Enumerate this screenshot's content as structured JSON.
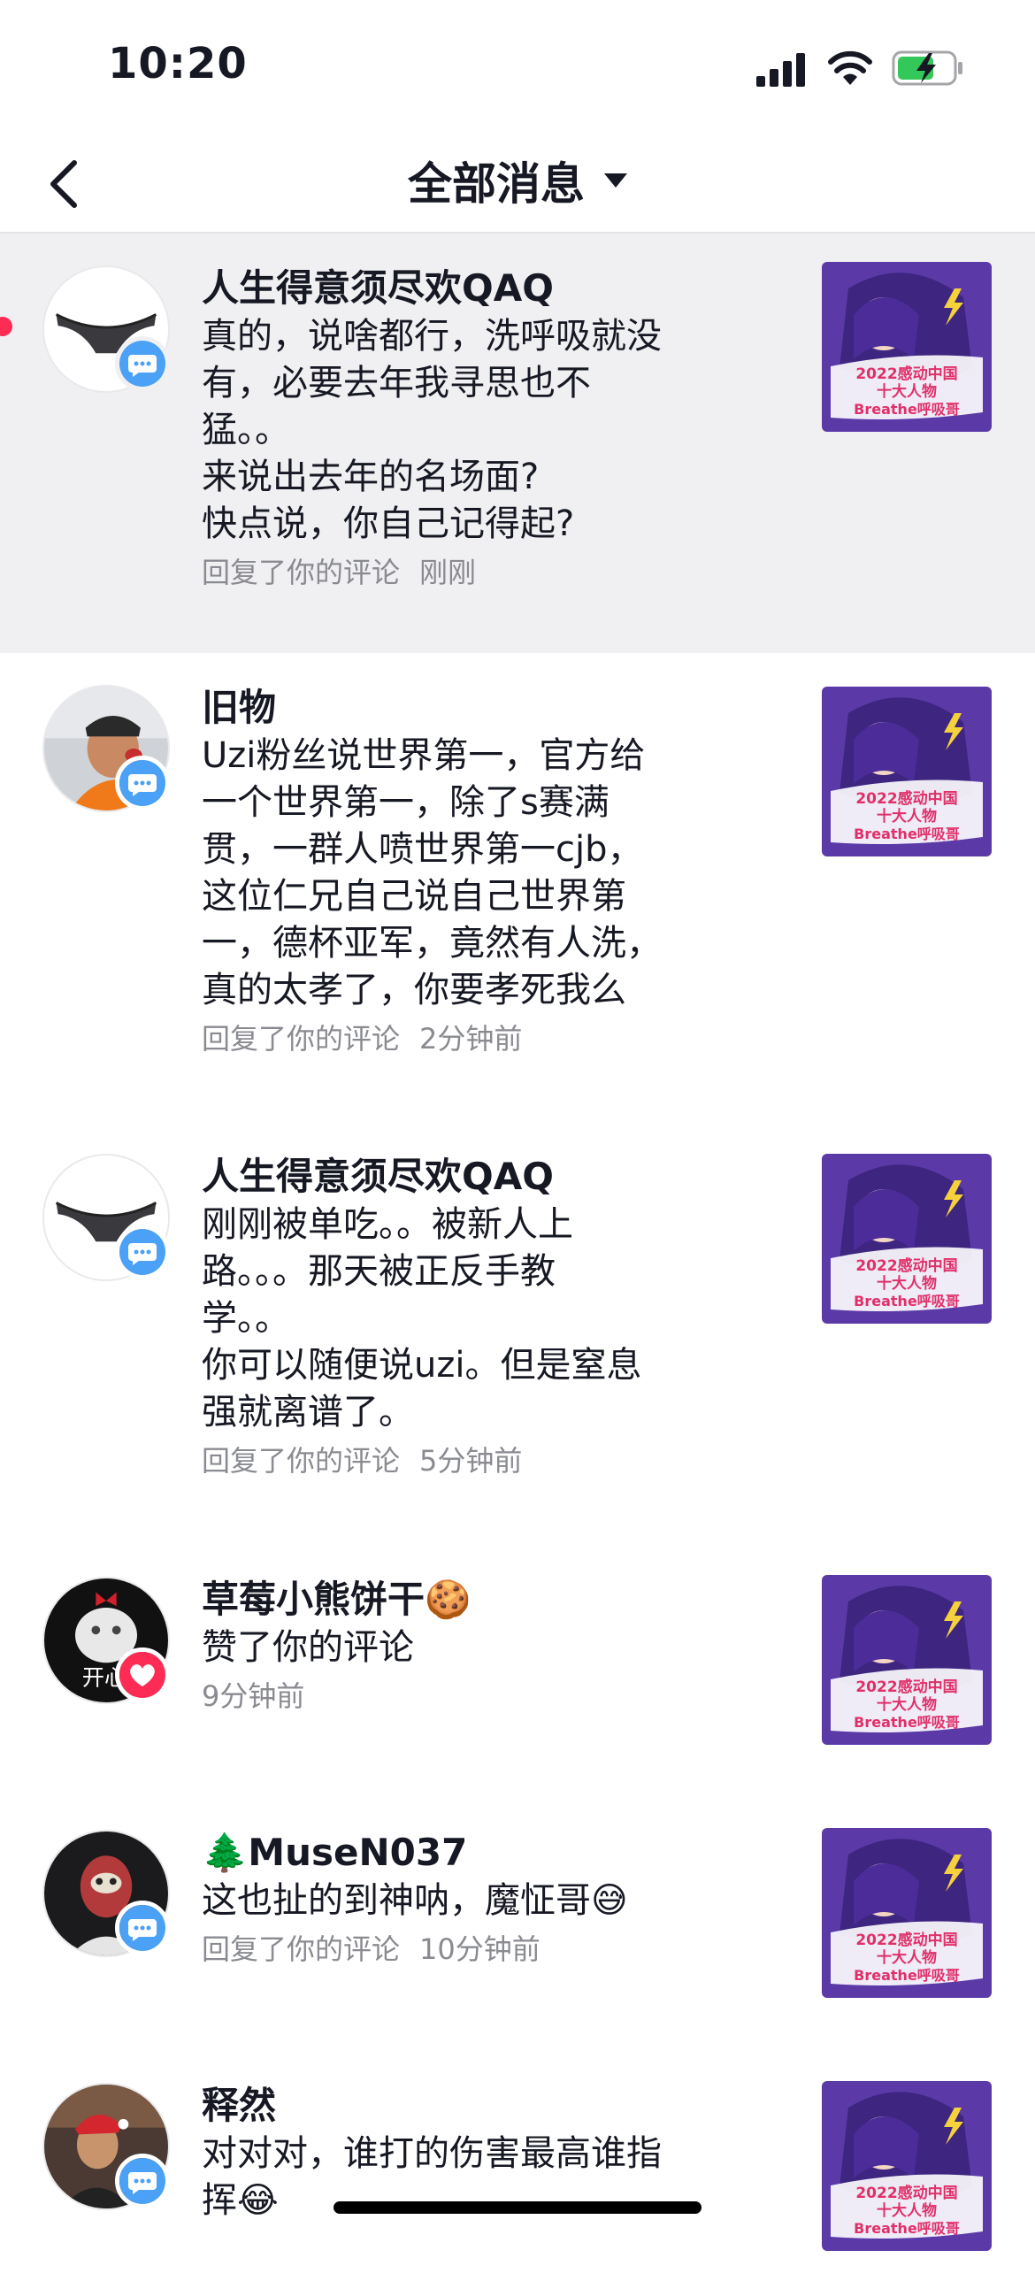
{
  "status_bar": {
    "time": "10:20"
  },
  "nav": {
    "title": "全部消息"
  },
  "messages": [
    {
      "name": "人生得意须尽欢QAQ",
      "lines": [
        "真的，说啥都行，洗呼吸就没",
        "有，必要去年我寻思也不",
        "猛。。",
        "来说出去年的名场面?",
        "快点说，你自己记得起?"
      ],
      "action": "回复了你的评论",
      "time": "刚刚",
      "badge": "comment-icon"
    },
    {
      "name": "旧物",
      "lines": [
        "Uzi粉丝说世界第一，官方给",
        "一个世界第一，除了s赛满",
        "贯，一群人喷世界第一cjb，",
        "这位仁兄自己说自己世界第",
        "一，德杯亚军，竟然有人洗，",
        "真的太孝了，你要孝死我么"
      ],
      "action": "回复了你的评论",
      "time": "2分钟前",
      "badge": "comment-icon"
    },
    {
      "name": "人生得意须尽欢QAQ",
      "lines": [
        "刚刚被单吃。。被新人上",
        "路。。。那天被正反手教",
        "学。。",
        "你可以随便说uzi。但是窒息",
        "强就离谱了。"
      ],
      "action": "回复了你的评论",
      "time": "5分钟前",
      "badge": "comment-icon"
    },
    {
      "name": "草莓小熊饼干🍪",
      "lines": [
        "赞了你的评论"
      ],
      "action": "",
      "time": "9分钟前",
      "badge": "heart-icon"
    },
    {
      "name": "🌲MuseN037",
      "lines": [
        "这也扯的到神呐，魔怔哥😅"
      ],
      "action": "回复了你的评论",
      "time": "10分钟前",
      "badge": "comment-icon"
    },
    {
      "name": "释然",
      "lines": [
        "对对对，谁打的伤害最高谁指",
        "挥😂"
      ],
      "action": "",
      "time": "",
      "badge": "comment-icon"
    }
  ],
  "thumbnail": {
    "title_lines": [
      "2022感动中国",
      "十大人物",
      "Breathe呼吸哥"
    ]
  },
  "colors": {
    "accent": "#fe2c55",
    "comment_badge": "#4ba1f5",
    "like_badge": "#fe2c55",
    "thumb_bg": "#5b3aa8"
  }
}
